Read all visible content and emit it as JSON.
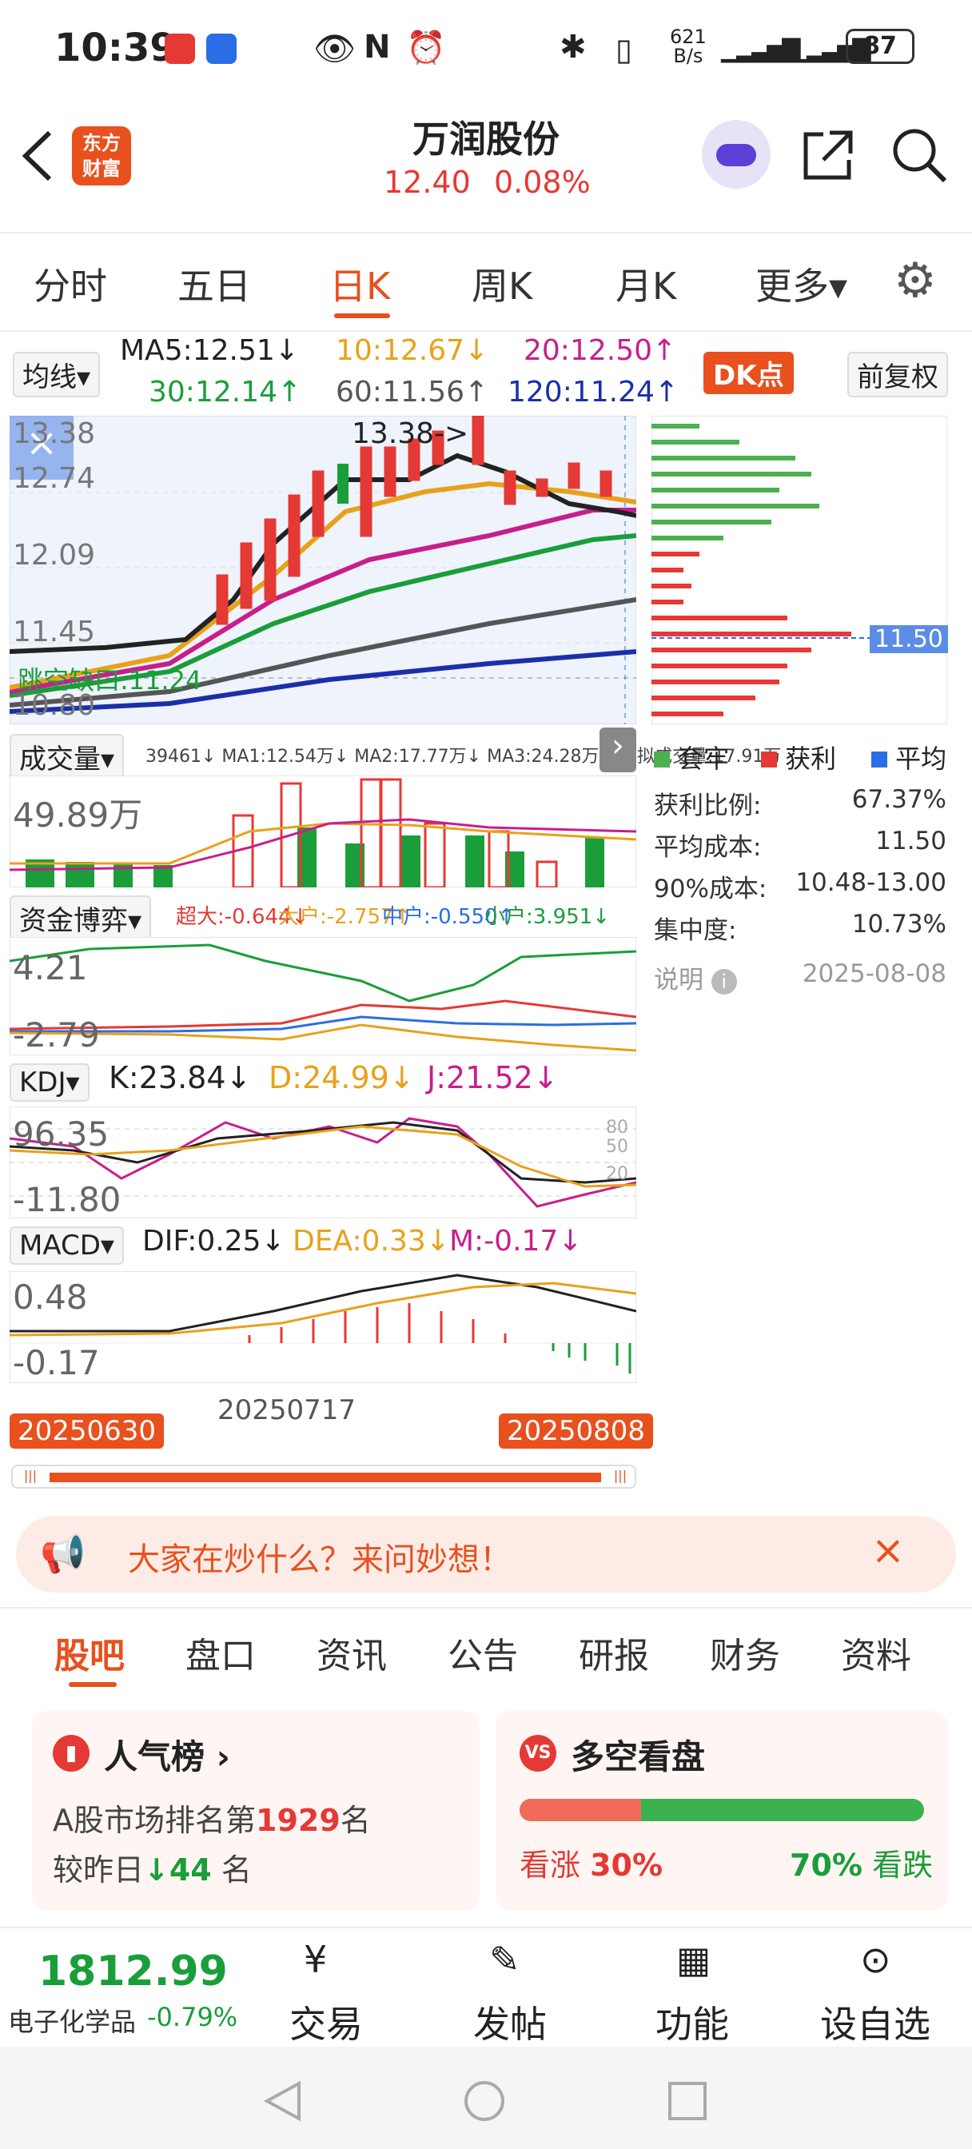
{
  "status": {
    "time": "10:39",
    "net": "621",
    "net_unit": "B/s",
    "battery": "87"
  },
  "header": {
    "title": "万润股份",
    "price": "12.40",
    "change": "0.08%",
    "logo": "东方\n财富"
  },
  "tabs": [
    "分时",
    "五日",
    "日K",
    "周K",
    "月K",
    "更多▾"
  ],
  "ma": {
    "selector": "均线▾",
    "ma5": "MA5:12.51↓",
    "ma10": "10:12.67↓",
    "ma20": "20:12.50↑",
    "ma30": "30:12.14↑",
    "ma60": "60:11.56↑",
    "ma120": "120:11.24↑",
    "dk": "DK点",
    "adj": "前复权"
  },
  "kline": {
    "high_label": "13.38->",
    "y": [
      "13.38",
      "12.74",
      "12.09",
      "11.45",
      "10.80"
    ],
    "support": "跳空缺口:11.24"
  },
  "volume": {
    "selector": "成交量▾",
    "sub": "39461↓ MA1:12.54万↓ MA2:17.77万↓ MA3:24.28万↓ 虚拟成交量:17.91万",
    "y": "49.89万"
  },
  "fund": {
    "selector": "资金博弈▾",
    "chaoda": "超大:-0.644↓",
    "dahu": "大户:-2.757↑",
    "zhonghu": "中户:-0.550↑",
    "xiaohu": "小户:3.951↓",
    "y1": "4.21",
    "y2": "-2.79"
  },
  "kdj": {
    "selector": "KDJ▾",
    "k": "K:23.84↓",
    "d": "D:24.99↓",
    "j": "J:21.52↓",
    "y1": "96.35",
    "y2": "-11.80",
    "lv": [
      "80",
      "50",
      "20"
    ]
  },
  "macd": {
    "selector": "MACD▾",
    "dif": "DIF:0.25↓",
    "dea": "DEA:0.33↓",
    "m": "M:-0.17↓",
    "y1": "0.48",
    "y2": "-0.17"
  },
  "dates": {
    "start": "20250630",
    "mid": "20250717",
    "end": "20250808"
  },
  "chip": {
    "price": "11.50",
    "legend": [
      "套牢",
      "获利",
      "平均"
    ],
    "rows": [
      [
        "获利比例:",
        "67.37%"
      ],
      [
        "平均成本:",
        "11.50"
      ],
      [
        "90%成本:",
        "10.48-13.00"
      ],
      [
        "集中度:",
        "10.73%"
      ]
    ],
    "note": "说明",
    "date": "2025-08-08"
  },
  "banner": {
    "text": "大家在炒什么？来问妙想！"
  },
  "bottom_tabs": [
    "股吧",
    "盘口",
    "资讯",
    "公告",
    "研报",
    "财务",
    "资料"
  ],
  "popular": {
    "title": "人气榜 ›",
    "line1a": "A股市场排名第",
    "rank": "1929",
    "line1b": "名",
    "line2a": "较昨日",
    "delta": "44",
    "line2b": "名"
  },
  "bullbear": {
    "title": "多空看盘",
    "up_label": "看涨",
    "up_pct": "30%",
    "down_pct": "70%",
    "down_label": "看跌",
    "up": 0.3
  },
  "index": {
    "value": "1812.99",
    "name": "电子化学品",
    "change": "-0.79%"
  },
  "nav": [
    "交易",
    "发帖",
    "功能",
    "设自选"
  ],
  "colors": {
    "accent": "#e8501e",
    "up": "#e53935",
    "down": "#1a9e3a"
  }
}
